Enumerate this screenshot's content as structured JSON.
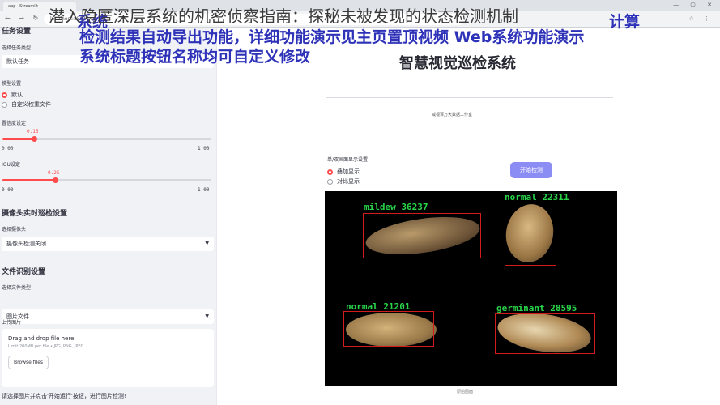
{
  "browser": {
    "tab_title": "app · Streamlit",
    "url": "localhost:8501",
    "window_controls": "— ▢ ✕",
    "nav": "← → ↻",
    "right_icons": "☆ ⋮"
  },
  "watermark": {
    "line1": "潜入隐匿深层系统的机密侦察指南：探秘未被发现的状态检测机制",
    "line2": "检测结果自动导出功能，详细功能演示见主页置顶视频 Web系统功能演示",
    "line3": "系统标题按钮名称均可自定义修改",
    "side_text": "系统",
    "right_text": "计算"
  },
  "sidebar": {
    "task_section": "任务设置",
    "task_select_label": "选择任务类型",
    "task_value": "默认任务",
    "model_label": "模型设置",
    "model_options": [
      "默认",
      "自定义权重文件"
    ],
    "conf_label": "置信度设定",
    "conf_value": "0.15",
    "conf_min": "0.00",
    "conf_max": "1.00",
    "conf_fraction": 0.15,
    "iou_label": "IOU设定",
    "iou_value": "0.25",
    "iou_min": "0.00",
    "iou_max": "1.00",
    "iou_fraction": 0.25,
    "camera_section": "摄像头实时巡检设置",
    "camera_label": "选择摄像头",
    "camera_value": "摄像头检测关闭",
    "file_section": "文件识别设置",
    "file_type_label": "选择文件类型",
    "file_type_value": "图片文件",
    "upload_label": "上传图片",
    "drop_title": "Drag and drop file here",
    "drop_limit": "Limit 200MB per file • JPG, PNG, JPEG",
    "browse_label": "Browse files",
    "hint": "请选择图片并点击'开始运行'按钮，进行图片检测!"
  },
  "main": {
    "title": "智慧视觉巡检系统",
    "divider_text": "威视百万大数据工作室",
    "mode_label": "单/双画面显示设置",
    "mode_options": [
      "叠加显示",
      "对比显示"
    ],
    "start_button": "开始检测",
    "image_caption": "原始图面"
  },
  "detections": [
    {
      "label": "mildew 36237"
    },
    {
      "label": "normal 22311"
    },
    {
      "label": "normal 21201"
    },
    {
      "label": "germinant 28595"
    }
  ],
  "colors": {
    "accent": "#ff4b4b",
    "button": "#8c8cf5",
    "box": "#d11c1c",
    "label": "#29d64a",
    "watermark_blue": "#2e32b8"
  }
}
